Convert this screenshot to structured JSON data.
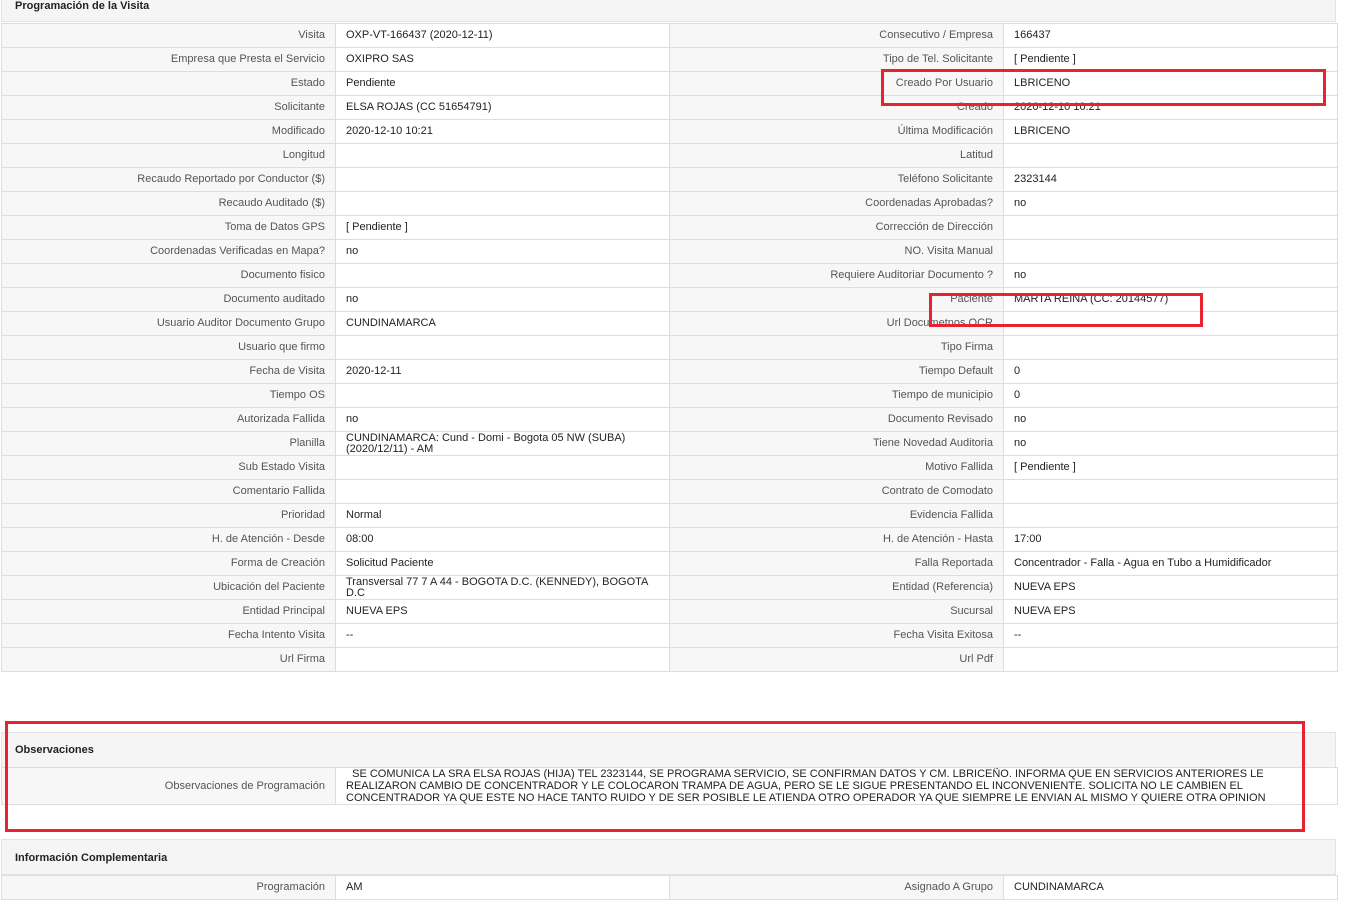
{
  "sections": {
    "programacion": "Programación de la Visita",
    "observaciones": "Observaciones",
    "complementaria": "Información Complementaria"
  },
  "rows": [
    {
      "l1": "Visita",
      "v1": "OXP-VT-166437 (2020-12-11)",
      "l2": "Consecutivo / Empresa",
      "v2": "166437"
    },
    {
      "l1": "Empresa que Presta el Servicio",
      "v1": "OXIPRO SAS",
      "l2": "Tipo de Tel. Solicitante",
      "v2": "[ Pendiente ]"
    },
    {
      "l1": "Estado",
      "v1": "Pendiente",
      "l2": "Creado Por Usuario",
      "v2": "LBRICENO"
    },
    {
      "l1": "Solicitante",
      "v1": "ELSA ROJAS (CC 51654791)",
      "l2": "Creado",
      "v2": "2020-12-10 10:21"
    },
    {
      "l1": "Modificado",
      "v1": "2020-12-10 10:21",
      "l2": "Última Modificación",
      "v2": " LBRICENO"
    },
    {
      "l1": "Longitud",
      "v1": "",
      "l2": "Latitud",
      "v2": ""
    },
    {
      "l1": "Recaudo Reportado por Conductor ($)",
      "v1": "",
      "l2": "Teléfono Solicitante",
      "v2": "2323144"
    },
    {
      "l1": "Recaudo Auditado ($)",
      "v1": "",
      "l2": "Coordenadas Aprobadas?",
      "v2": " no"
    },
    {
      "l1": "Toma de Datos GPS",
      "v1": "[ Pendiente ]",
      "l2": "Corrección de Dirección",
      "v2": ""
    },
    {
      "l1": "Coordenadas Verificadas en Mapa?",
      "v1": " no",
      "l2": "NO. Visita Manual",
      "v2": ""
    },
    {
      "l1": "Documento fisico",
      "v1": "",
      "l2": "Requiere Auditoriar Documento ?",
      "v2": " no"
    },
    {
      "l1": "Documento auditado",
      "v1": " no",
      "l2": "Paciente",
      "v2": "MARTA REINA (CC: 20144577)"
    },
    {
      "l1": "Usuario Auditor Documento Grupo",
      "v1": "CUNDINAMARCA",
      "l2": "Url Documetnos OCR",
      "v2": ""
    },
    {
      "l1": "Usuario que firmo",
      "v1": "",
      "l2": "Tipo Firma",
      "v2": ""
    },
    {
      "l1": "Fecha de Visita",
      "v1": " 2020-12-11",
      "l2": "Tiempo Default",
      "v2": "0"
    },
    {
      "l1": "Tiempo OS",
      "v1": "",
      "l2": "Tiempo de municipio",
      "v2": "0"
    },
    {
      "l1": "Autorizada Fallida",
      "v1": " no",
      "l2": "Documento Revisado",
      "v2": " no"
    },
    {
      "l1": "Planilla",
      "v1": "CUNDINAMARCA: Cund - Domi - Bogota 05 NW (SUBA) (2020/12/11) - AM",
      "l2": "Tiene Novedad Auditoria",
      "v2": " no"
    },
    {
      "l1": "Sub Estado Visita",
      "v1": "",
      "l2": "Motivo Fallida",
      "v2": "[ Pendiente ]"
    },
    {
      "l1": "Comentario Fallida",
      "v1": "",
      "l2": "Contrato de Comodato",
      "v2": ""
    },
    {
      "l1": "Prioridad",
      "v1": "Normal",
      "l2": "Evidencia Fallida",
      "v2": ""
    },
    {
      "l1": "H. de Atención - Desde",
      "v1": "08:00",
      "l2": "H. de Atención - Hasta",
      "v2": "17:00"
    },
    {
      "l1": "Forma de Creación",
      "v1": "Solicitud Paciente",
      "l2": "Falla Reportada",
      "v2": "Concentrador - Falla - Agua en Tubo a Humidificador"
    },
    {
      "l1": "Ubicación del Paciente",
      "v1": "Transversal 77 7 A 44 - BOGOTA D.C. (KENNEDY), BOGOTA D.C",
      "l2": "Entidad (Referencia)",
      "v2": "NUEVA EPS"
    },
    {
      "l1": "Entidad Principal",
      "v1": "NUEVA EPS",
      "l2": "Sucursal",
      "v2": "NUEVA EPS"
    },
    {
      "l1": "Fecha Intento Visita",
      "v1": "--",
      "l2": "Fecha Visita Exitosa",
      "v2": " --"
    },
    {
      "l1": "Url Firma",
      "v1": "",
      "l2": "Url Pdf",
      "v2": ""
    }
  ],
  "observaciones": {
    "label": "Observaciones de Programación",
    "text": "  SE COMUNICA LA SRA ELSA ROJAS (HIJA) TEL 2323144, SE PROGRAMA SERVICIO, SE CONFIRMAN DATOS Y CM. LBRICEÑO. INFORMA QUE EN SERVICIOS ANTERIORES LE REALIZARON CAMBIO DE CONCENTRADOR Y LE COLOCARON TRAMPA DE AGUA, PERO SE LE SIGUE PRESENTANDO EL INCONVENIENTE. SOLICITA NO LE CAMBIEN EL CONCENTRADOR YA QUE ESTE NO HACE TANTO RUIDO Y DE SER POSIBLE LE ATIENDA OTRO OPERADOR YA QUE SIEMPRE LE ENVIAN AL MISMO Y QUIERE OTRA OPINION"
  },
  "complementaria": [
    {
      "l1": "Programación",
      "v1": "AM",
      "l2": "Asignado A Grupo",
      "v2": "CUNDINAMARCA"
    }
  ],
  "colors": {
    "highlight": "#e8232f",
    "header_bg": "#f5f5f5",
    "label_bg": "#f7f7f7",
    "border": "#dddddd"
  }
}
